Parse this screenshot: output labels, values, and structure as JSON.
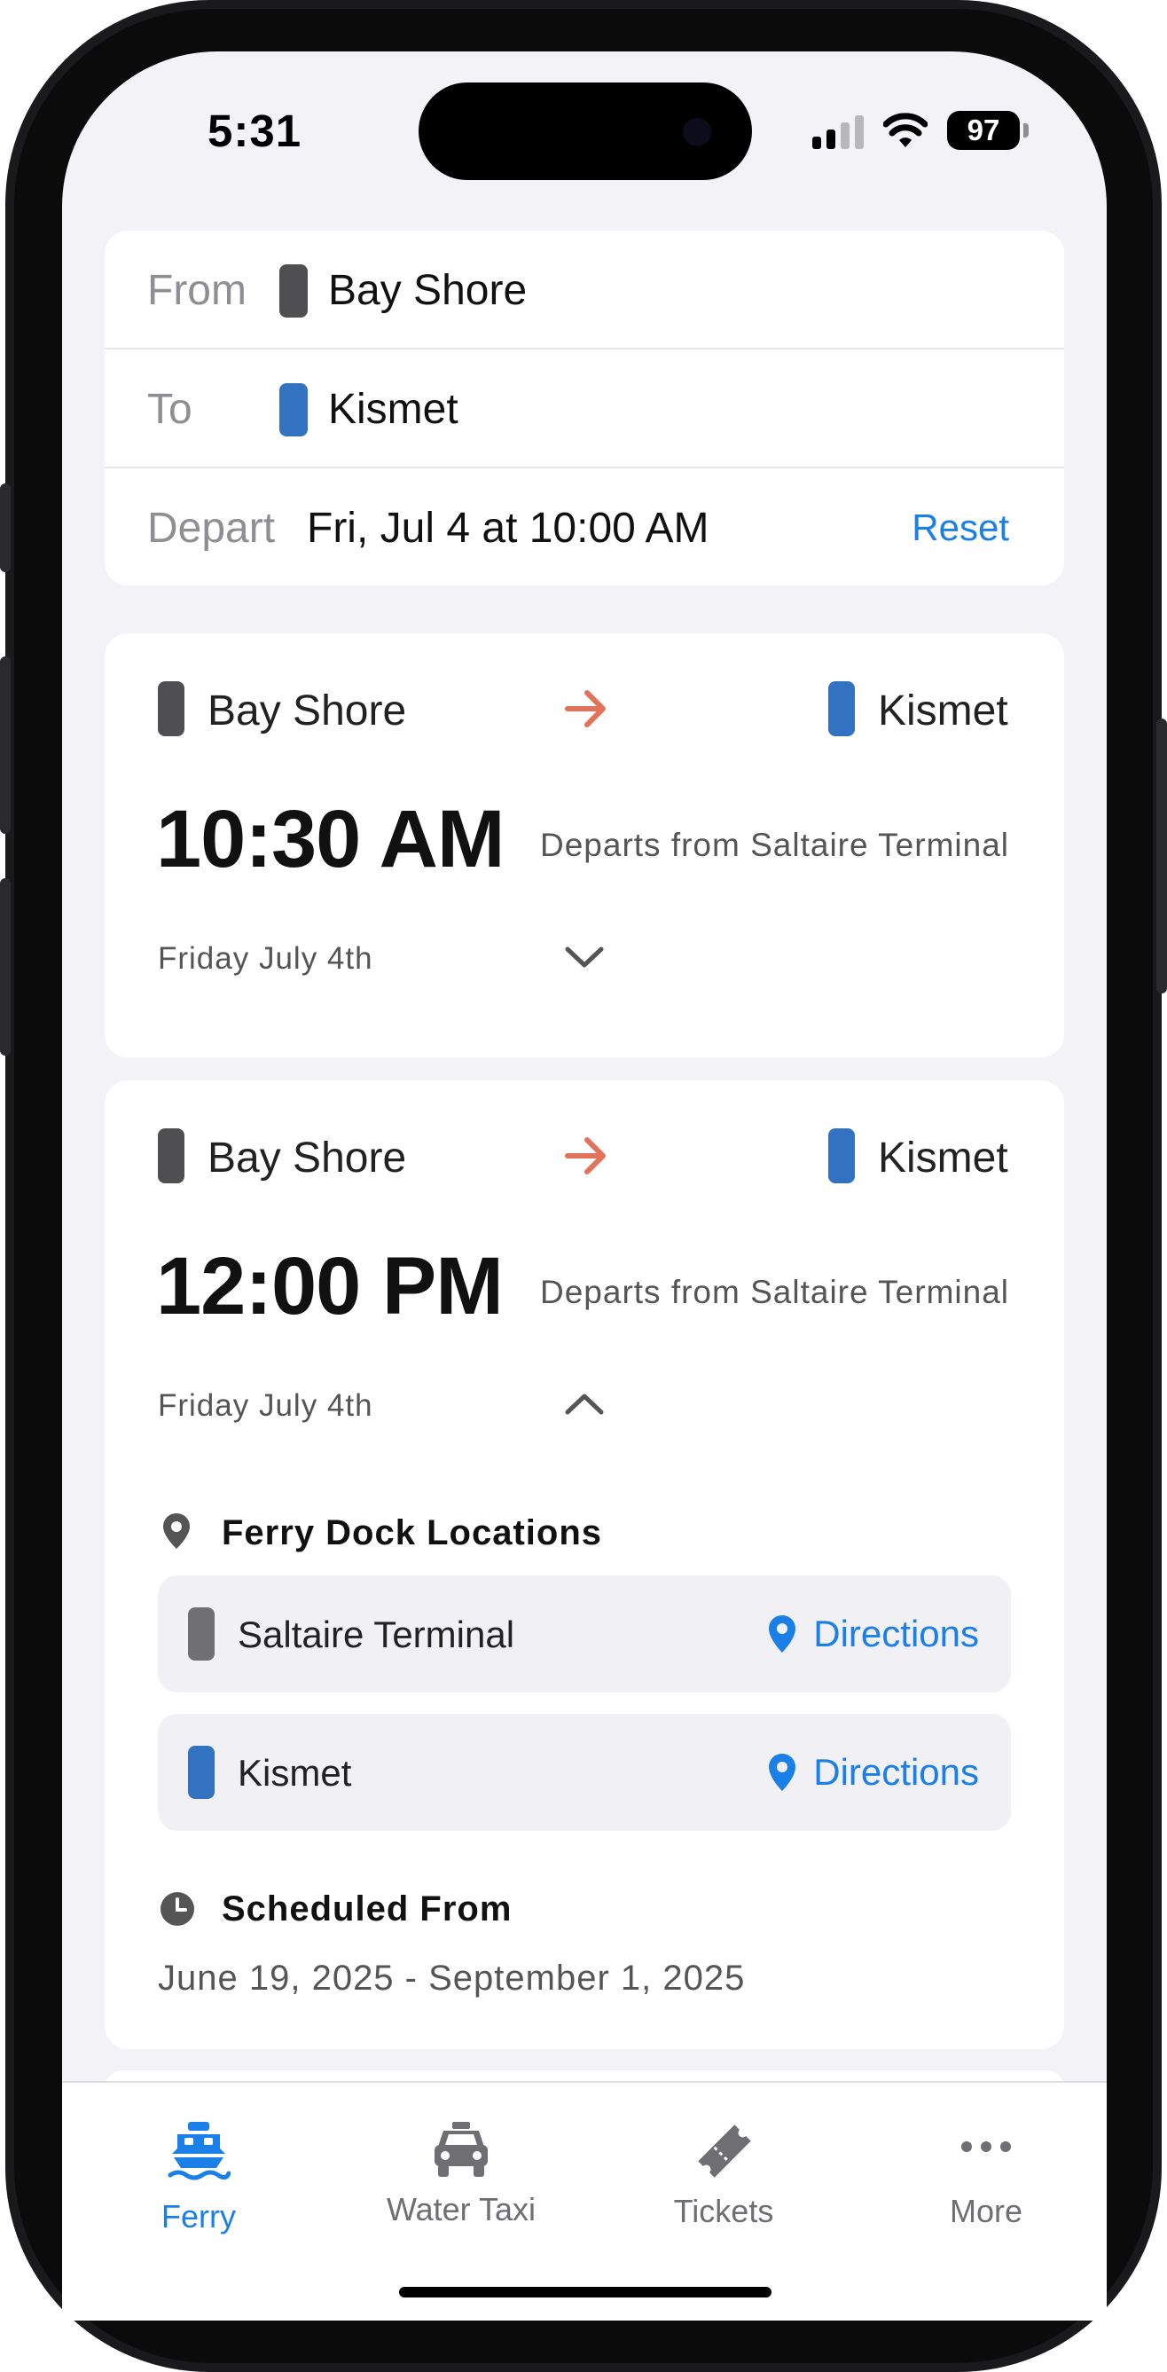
{
  "status_bar": {
    "time": "5:31",
    "battery": "97"
  },
  "search": {
    "from_label": "From",
    "from_value": "Bay Shore",
    "to_label": "To",
    "to_value": "Kismet",
    "depart_label": "Depart",
    "depart_value": "Fri, Jul 4 at 10:00 AM",
    "reset_label": "Reset"
  },
  "trips": [
    {
      "origin": "Bay Shore",
      "destination": "Kismet",
      "time": "10:30 AM",
      "departs_note": "Departs from Saltaire Terminal",
      "date": "Friday July 4th",
      "expanded": false
    },
    {
      "origin": "Bay Shore",
      "destination": "Kismet",
      "time": "12:00 PM",
      "departs_note": "Departs from Saltaire Terminal",
      "date": "Friday July 4th",
      "expanded": true,
      "dock_heading": "Ferry Dock Locations",
      "docks": [
        {
          "name": "Saltaire Terminal",
          "directions_label": "Directions"
        },
        {
          "name": "Kismet",
          "directions_label": "Directions"
        }
      ],
      "schedule_heading": "Scheduled From",
      "schedule_range": "June 19, 2025 - September 1, 2025"
    }
  ],
  "tabs": [
    {
      "label": "Ferry",
      "icon": "ferry-icon",
      "active": true
    },
    {
      "label": "Water Taxi",
      "icon": "taxi-icon",
      "active": false
    },
    {
      "label": "Tickets",
      "icon": "ticket-icon",
      "active": false
    },
    {
      "label": "More",
      "icon": "more-icon",
      "active": false
    }
  ],
  "colors": {
    "accent": "#1a7fe6",
    "origin_marker": "#4f4f51",
    "destination_marker": "#3272c1",
    "route_arrow": "#e0735a",
    "background": "#f2f2f7"
  }
}
